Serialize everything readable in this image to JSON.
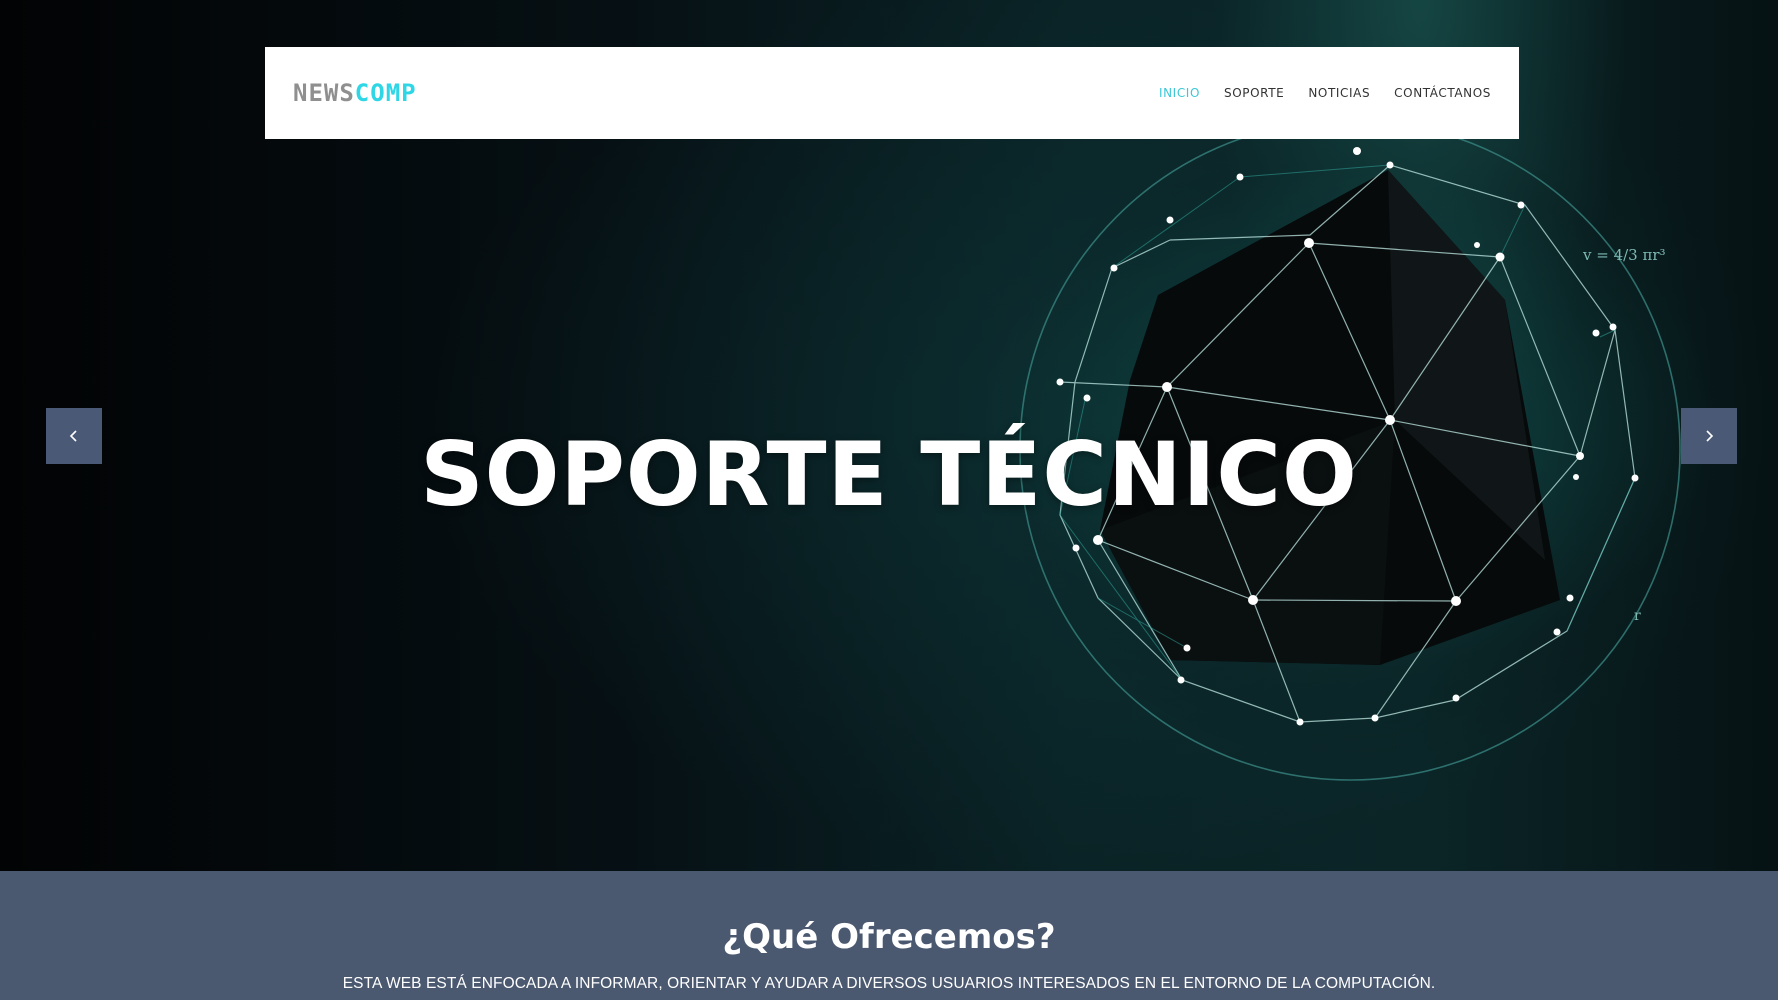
{
  "brand": {
    "logo_part1": "NEWS",
    "logo_part2": "COMP",
    "accent_color": "#2fd6e6"
  },
  "nav": {
    "items": [
      {
        "label": "INICIO",
        "active": true
      },
      {
        "label": "SOPORTE",
        "active": false
      },
      {
        "label": "NOTICIAS",
        "active": false
      },
      {
        "label": "CONTÁCTANOS",
        "active": false
      }
    ]
  },
  "hero": {
    "headline": "SOPORTE TÉCNICO",
    "formula": "v = 4/3 πr³",
    "radius_label": "r",
    "prev_icon": "chevron-left-icon",
    "next_icon": "chevron-right-icon"
  },
  "offer": {
    "title": "¿Qué Ofrecemos?",
    "text": "ESTA WEB ESTÁ ENFOCADA A INFORMAR, ORIENTAR Y AYUDAR A DIVERSOS USUARIOS INTERESADOS EN EL ENTORNO DE LA COMPUTACIÓN.",
    "background_color": "#4a5870"
  }
}
